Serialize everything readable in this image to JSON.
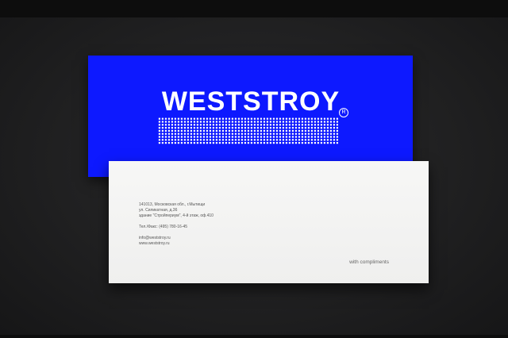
{
  "brand": {
    "name": "WESTSTROY",
    "reg_symbol": "R",
    "color": "#0d19ff"
  },
  "card": {
    "address_lines": [
      "141013, Московская обл., г.Мытищи",
      "ул. Силикатная, д.36",
      "здание \"Стройпериум\", 4-й этаж, оф.410"
    ],
    "phone": "Тел./Факс: (495) 780-16-45",
    "email": "info@weststroy.ru",
    "website": "www.weststroy.ru",
    "compliments": "with compliments"
  }
}
